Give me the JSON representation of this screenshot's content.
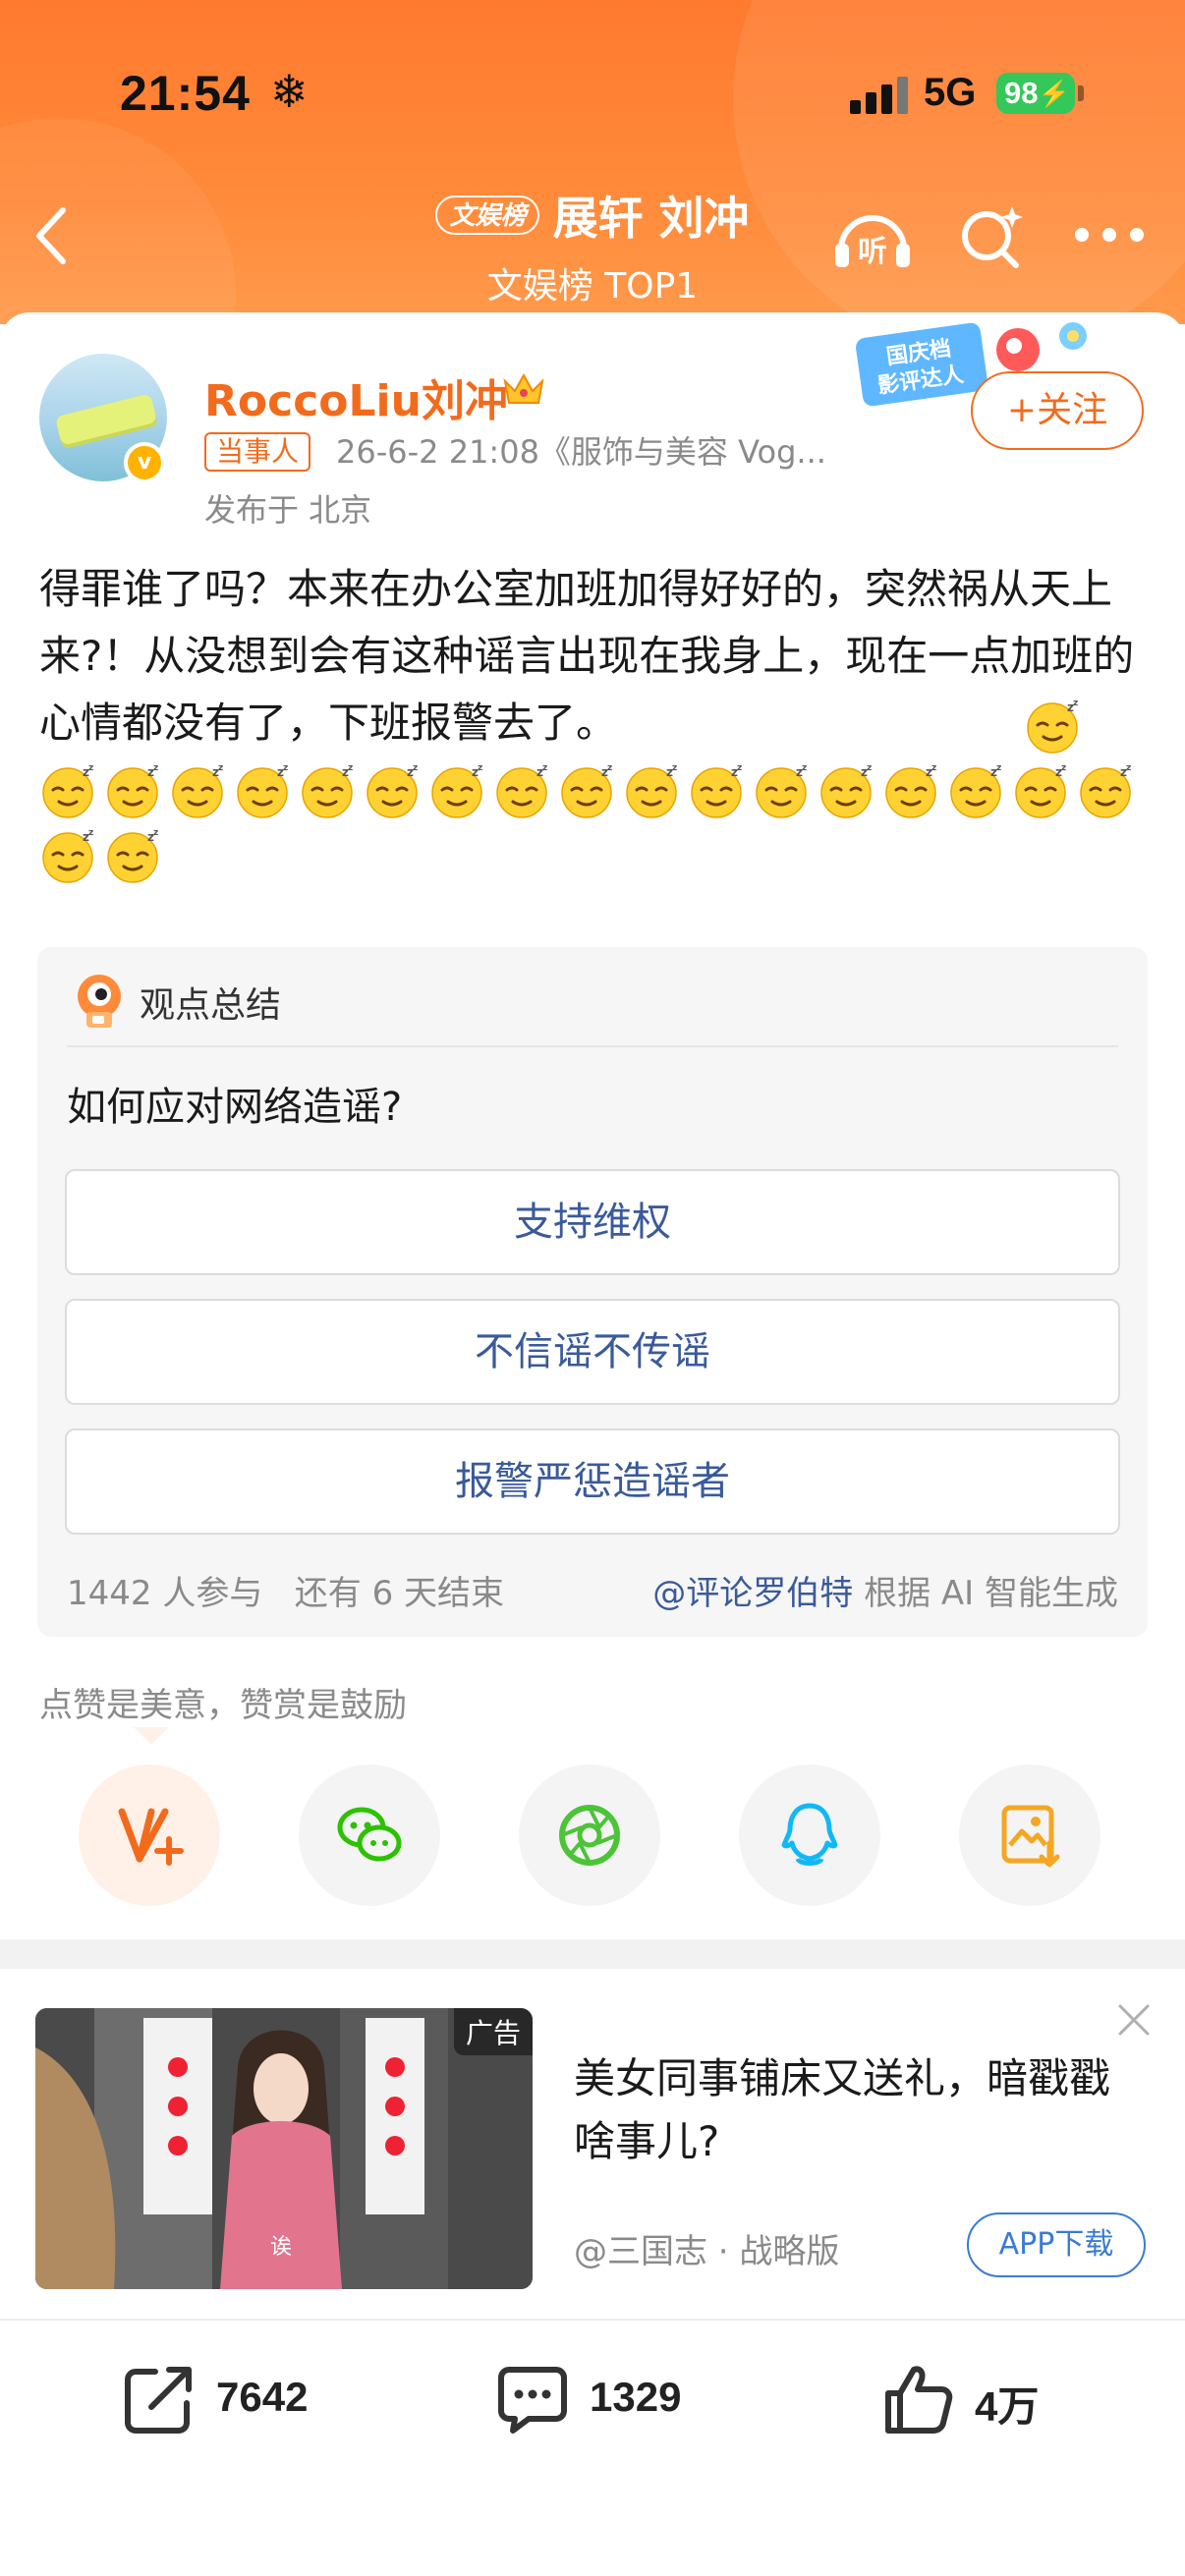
{
  "status_bar": {
    "time": "21:54",
    "network": "5G",
    "battery": "98"
  },
  "nav": {
    "tag": "文娱榜",
    "title": "展轩 刘冲",
    "subtitle": "文娱榜 TOP1",
    "listen_label": "听"
  },
  "post": {
    "username": "RoccoLiu刘冲",
    "role_tag": "当事人",
    "meta": "26-6-2 21:08《服饰与美容 Vog...",
    "location": "发布于 北京",
    "follow_label": "+关注",
    "promo_badge": "国庆档影评达人",
    "text": "得罪谁了吗？本来在办公室加班加得好好的，突然祸从天上来?！从没想到会有这种谣言出现在我身上，现在一点加班的心情都没有了，下班报警去了。",
    "emoji_count": 20,
    "emoji_name": "sleepy-face-emoji"
  },
  "poll": {
    "header": "观点总结",
    "question": "如何应对网络造谣?",
    "options": [
      "支持维权",
      "不信谣不传谣",
      "报警严惩造谣者"
    ],
    "participants": "1442 人参与",
    "remaining": "还有 6 天结束",
    "credit_link": "@评论罗伯特",
    "credit_text": "根据 AI 智能生成"
  },
  "reward_hint": "点赞是美意，赞赏是鼓励",
  "share_icons": [
    "reward-icon",
    "wechat-icon",
    "moments-icon",
    "qq-icon",
    "save-image-icon"
  ],
  "ad": {
    "label": "广告",
    "title": "美女同事铺床又送礼，暗戳戳啥事儿?",
    "source": "@三国志 · 战略版",
    "download_label": "APP下载",
    "caption": "诶"
  },
  "actions": {
    "repost": "7642",
    "comments": "1329",
    "likes": "4万"
  },
  "colors": {
    "brand_orange": "#f26b1d",
    "header_orange": "#ff7a2e",
    "link_blue": "#3a5a9a"
  }
}
